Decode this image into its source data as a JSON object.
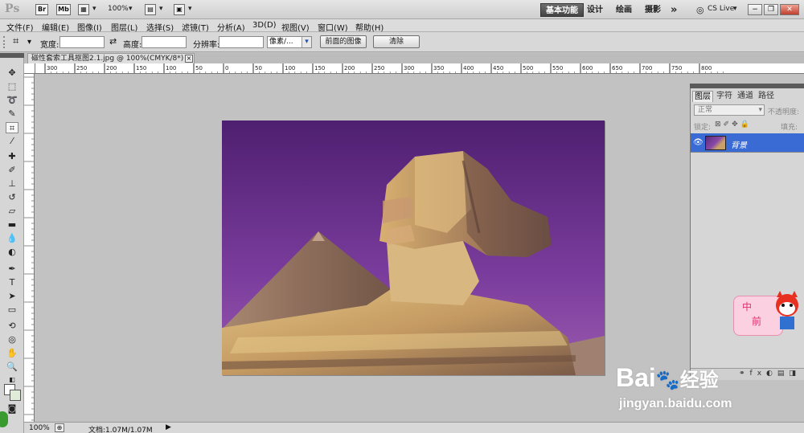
{
  "appbar": {
    "logo": "Ps",
    "bridge_btn": "Br",
    "minibridge_btn": "Mb",
    "zoom": "100%",
    "workspaces": [
      "基本功能",
      "设计",
      "绘画",
      "摄影"
    ],
    "more": "»",
    "cslive": "CS Live"
  },
  "menu": [
    "文件(F)",
    "编辑(E)",
    "图像(I)",
    "图层(L)",
    "选择(S)",
    "滤镜(T)",
    "分析(A)",
    "3D(D)",
    "视图(V)",
    "窗口(W)",
    "帮助(H)"
  ],
  "options": {
    "width_label": "宽度:",
    "width_value": "",
    "height_label": "高度:",
    "height_value": "",
    "resolution_label": "分辨率:",
    "resolution_value": "",
    "unit_select": "像素/...",
    "front_image_btn": "前面的图像",
    "clear_btn": "清除"
  },
  "document": {
    "tab_title": "磁性套索工具抠图2.1.jpg @ 100%(CMYK/8*)",
    "close": "×"
  },
  "ruler_h": [
    "300",
    "250",
    "200",
    "150",
    "100",
    "50",
    "0",
    "50",
    "100",
    "150",
    "200",
    "250",
    "300",
    "350",
    "400",
    "450",
    "500",
    "550",
    "600",
    "650",
    "700",
    "750",
    "800"
  ],
  "status": {
    "zoom": "100%",
    "doc_info": "文档:1.07M/1.07M"
  },
  "layers_panel": {
    "tabs": [
      "图层",
      "字符",
      "通道",
      "路径"
    ],
    "blend_mode": "正常",
    "opacity_label": "不透明度:",
    "lock_label": "锁定:",
    "fill_label": "填充:",
    "layer_name": "背景"
  },
  "watermark": {
    "brand": "Bai",
    "brand2": "经验",
    "url": "jingyan.baidu.com",
    "badge1": "中",
    "badge2": "前"
  },
  "colors": {
    "sky_top": "#5a2a7a",
    "sky_bottom": "#8a4aa8",
    "stone": "#c8a068",
    "layer_selected": "#3a6ad4"
  }
}
